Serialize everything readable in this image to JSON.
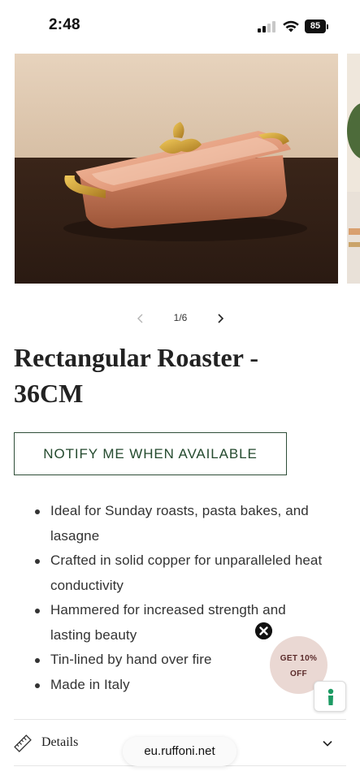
{
  "status_bar": {
    "time": "2:48",
    "battery": "85"
  },
  "gallery": {
    "counter": "1/6",
    "images": [
      {
        "icon": "copper-roaster-photo"
      },
      {
        "icon": "next-product-photo-partial"
      }
    ]
  },
  "product": {
    "title_line1": "Rectangular Roaster -",
    "title_line2": "36CM",
    "notify_label": "NOTIFY ME WHEN AVAILABLE",
    "features": [
      {
        "line1": "Ideal for Sunday roasts, pasta bakes, and",
        "line2": "lasagne"
      },
      {
        "line1": "Crafted in solid copper for unparalleled heat",
        "line2": "conductivity"
      },
      {
        "line1": "Hammered for increased strength and",
        "line2": "lasting beauty"
      },
      {
        "line1": "Tin-lined by hand over fire",
        "line2": ""
      },
      {
        "line1": "Made in Italy",
        "line2": ""
      }
    ]
  },
  "promo": {
    "line1": "GET 10%",
    "line2": "OFF"
  },
  "details": {
    "label": "Details"
  },
  "browser": {
    "url": "eu.ruffoni.net"
  },
  "colors": {
    "notify_border": "#2f4e38",
    "notify_text": "#244a2e",
    "promo_bg": "#ead8d3",
    "copper": "#d98a6a"
  }
}
